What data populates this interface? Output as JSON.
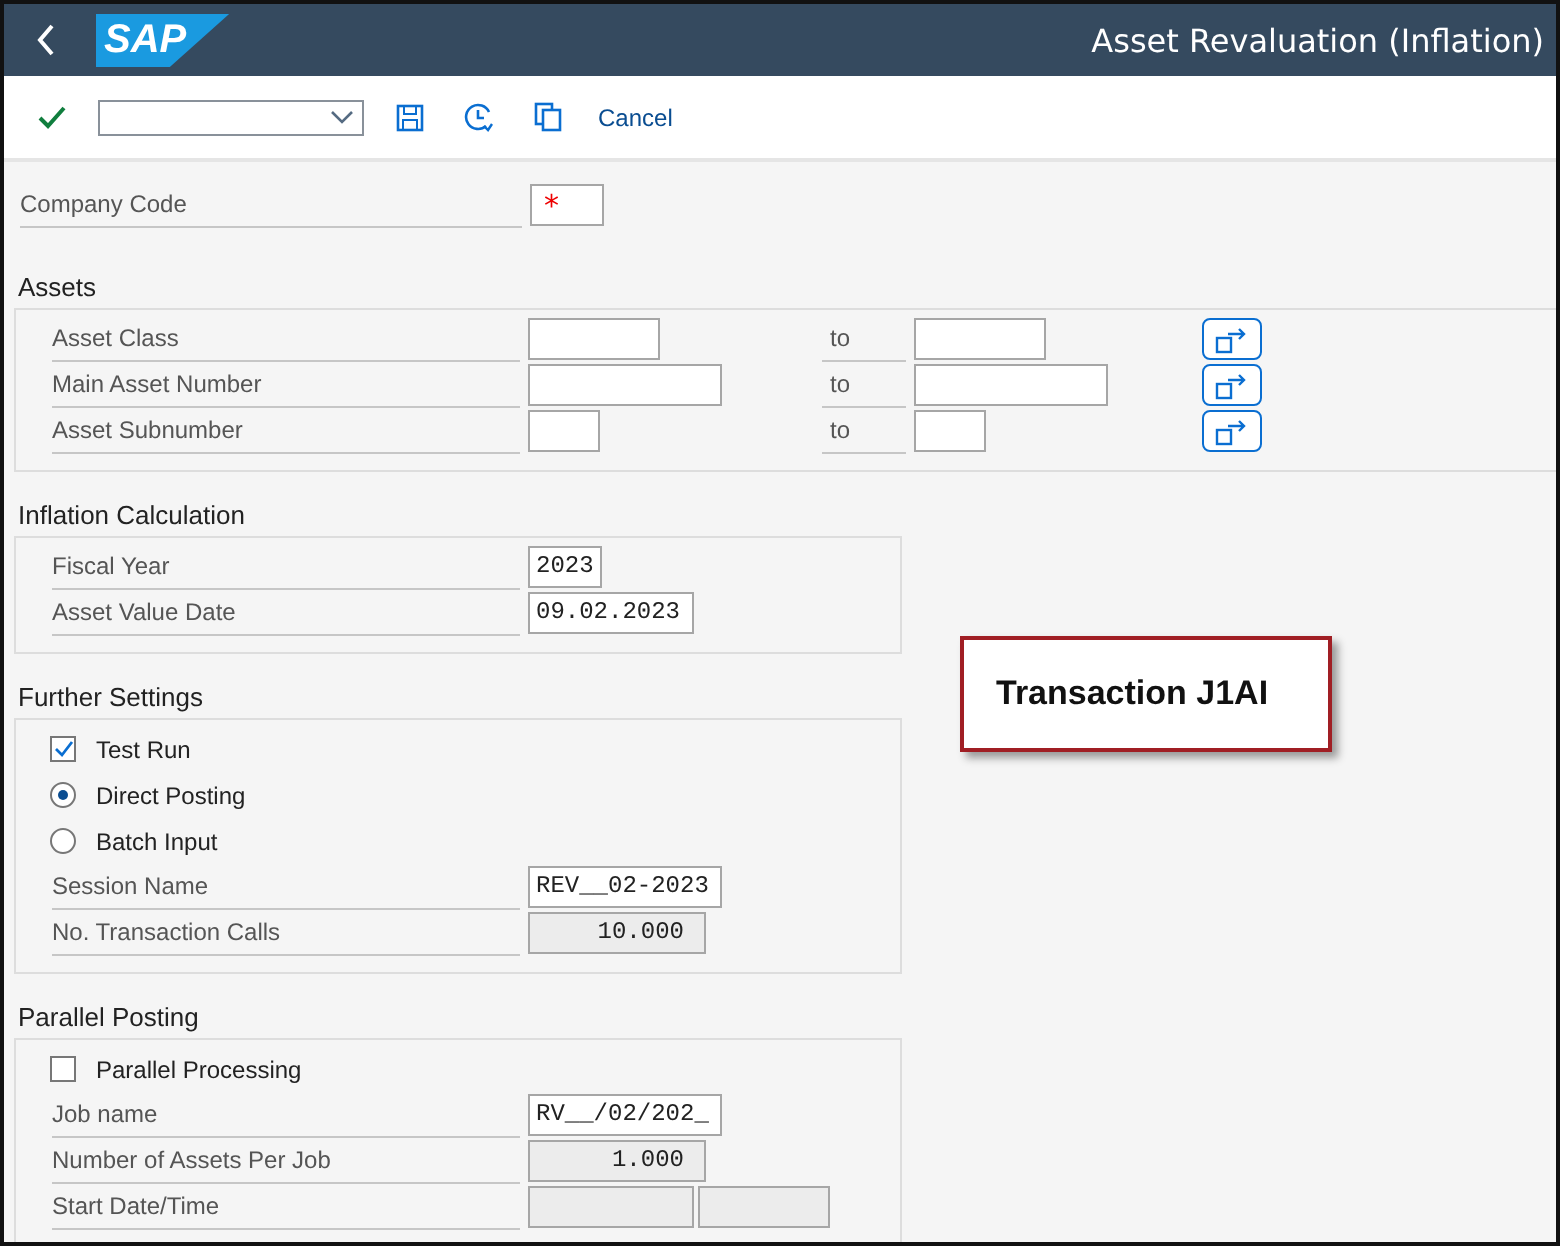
{
  "header": {
    "logo": "SAP",
    "title": "Asset Revaluation (Inflation)"
  },
  "toolbar": {
    "cancel": "Cancel"
  },
  "company_code": {
    "label": "Company Code",
    "mark": "*"
  },
  "assets": {
    "title": "Assets",
    "rows": [
      {
        "label": "Asset Class",
        "to": "to"
      },
      {
        "label": "Main Asset Number",
        "to": "to"
      },
      {
        "label": "Asset Subnumber",
        "to": "to"
      }
    ]
  },
  "inflation": {
    "title": "Inflation Calculation",
    "rows": [
      {
        "label": "Fiscal Year",
        "value": "2023",
        "readonly": false
      },
      {
        "label": "Asset Value Date",
        "value": "09.02.2023",
        "readonly": false
      }
    ]
  },
  "further": {
    "title": "Further Settings",
    "options": [
      {
        "kind": "checkbox",
        "label": "Test Run",
        "checked": true
      },
      {
        "kind": "radio",
        "label": "Direct Posting",
        "selected": true
      },
      {
        "kind": "radio",
        "label": "Batch Input",
        "selected": false
      }
    ],
    "rows": [
      {
        "label": "Session Name",
        "value": "REV__02-2023",
        "readonly": false
      },
      {
        "label": "No. Transaction Calls",
        "value": "10.000",
        "readonly": true
      }
    ]
  },
  "parallel": {
    "title": "Parallel Posting",
    "options": [
      {
        "kind": "checkbox",
        "label": "Parallel Processing",
        "checked": false
      }
    ],
    "rows": [
      {
        "label": "Job name",
        "value": "RV__/02/202_",
        "readonly": false
      },
      {
        "label": "Number of Assets Per Job",
        "value": "1.000",
        "readonly": true
      },
      {
        "label": "Start Date/Time",
        "readonly": true
      }
    ]
  },
  "callout": {
    "text": "Transaction J1AI"
  }
}
